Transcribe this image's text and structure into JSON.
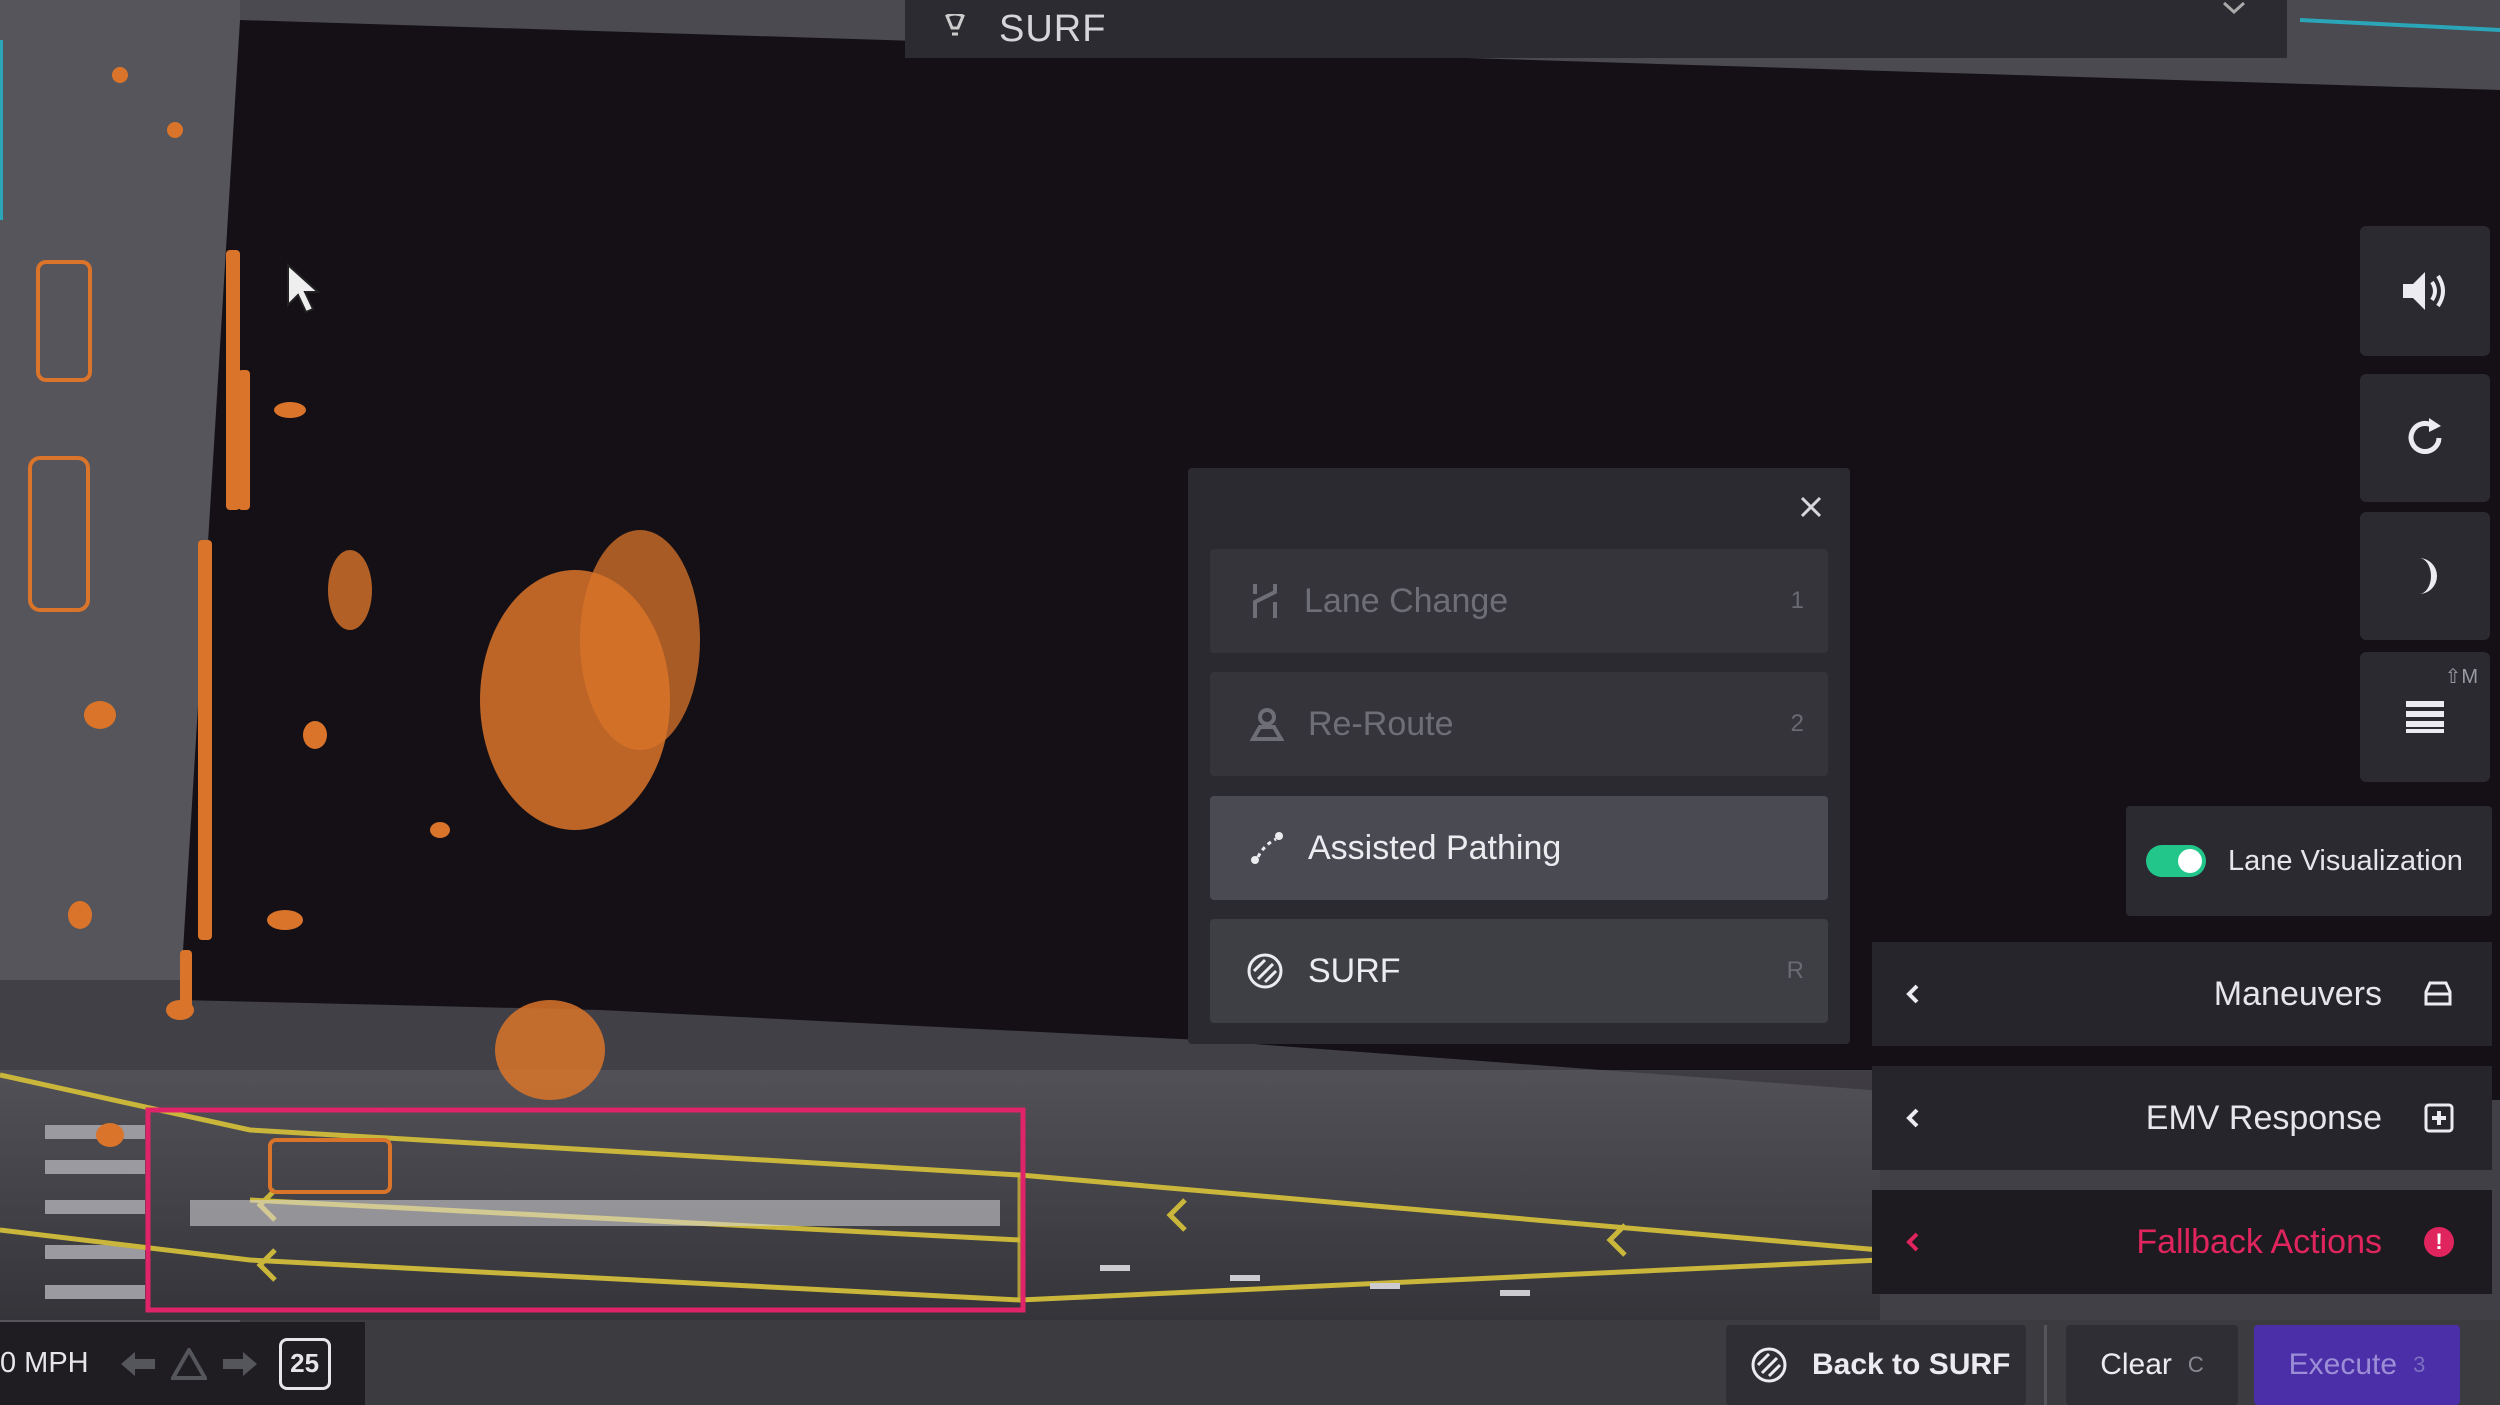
{
  "header": {
    "title": "SURF"
  },
  "maneuver_menu": {
    "items": [
      {
        "label": "Lane Change",
        "key": "1",
        "icon": "lane-change-icon",
        "state": "disabled"
      },
      {
        "label": "Re-Route",
        "key": "2",
        "icon": "reroute-icon",
        "state": "disabled"
      },
      {
        "label": "Assisted Pathing",
        "key": "",
        "icon": "assisted-pathing-icon",
        "state": "active"
      },
      {
        "label": "SURF",
        "key": "R",
        "icon": "surf-icon",
        "state": "enabled"
      }
    ]
  },
  "right_toolbar": {
    "sound": "speaker-icon",
    "refresh": "refresh-icon",
    "night": "moon-icon",
    "list": "list-icon",
    "list_shortcut": "⇧M"
  },
  "lane_visualization": {
    "label": "Lane Visualization",
    "enabled": true
  },
  "side_panels": {
    "maneuvers": "Maneuvers",
    "emv": "EMV Response",
    "fallback": "Fallback Actions"
  },
  "status": {
    "speed": "0 MPH",
    "speed_limit": "25"
  },
  "actions": {
    "back_to_surf": "Back to SURF",
    "clear": "Clear",
    "clear_key": "C",
    "execute": "Execute",
    "execute_key": "3"
  },
  "colors": {
    "accent_green": "#22c58a",
    "fallback_red": "#e0245e",
    "execute_purple": "#4b2fa8",
    "lidar_orange": "#d9742a",
    "lane_yellow": "#c9b63a",
    "route_pink": "#e0246a"
  }
}
